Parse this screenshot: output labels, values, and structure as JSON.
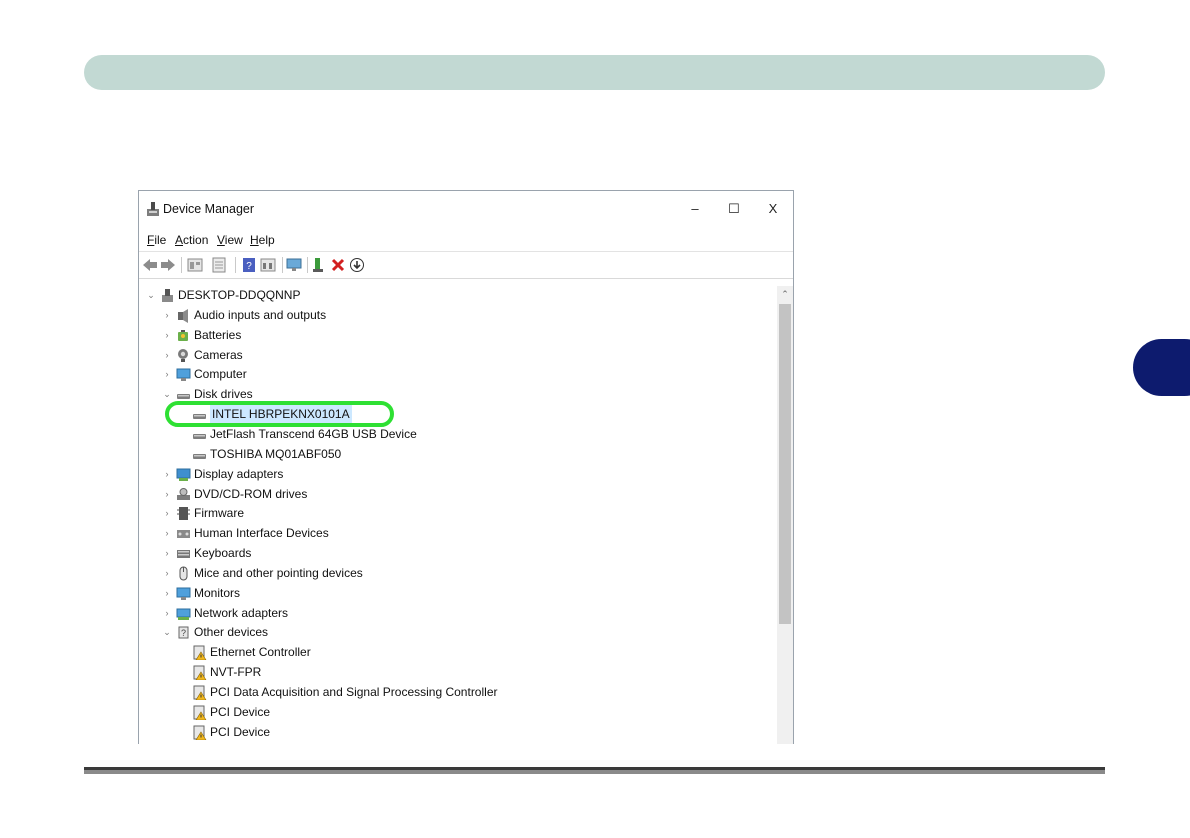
{
  "window": {
    "title": "Device Manager",
    "controls": {
      "minimize": "–",
      "maximize": "☐",
      "close": "X"
    }
  },
  "menu": {
    "items": [
      {
        "u": "F",
        "rest": "ile"
      },
      {
        "u": "A",
        "rest": "ction"
      },
      {
        "u": "V",
        "rest": "iew"
      },
      {
        "u": "H",
        "rest": "elp"
      }
    ]
  },
  "toolbar": {
    "icons": [
      "back-arrow-icon",
      "forward-arrow-icon",
      "properties-icon",
      "update-driver-list-icon",
      "help-icon",
      "show-hidden-icon",
      "monitor-icon",
      "enable-device-icon",
      "uninstall-icon",
      "scan-changes-icon"
    ]
  },
  "tree": {
    "rows": [
      {
        "label": "DESKTOP-DDQQNNP",
        "level": 0,
        "chevron": "⌄",
        "icon": "computer-root-icon"
      },
      {
        "label": "Audio inputs and outputs",
        "level": 1,
        "chevron": "›",
        "icon": "speaker-icon"
      },
      {
        "label": "Batteries",
        "level": 1,
        "chevron": "›",
        "icon": "battery-icon"
      },
      {
        "label": "Cameras",
        "level": 1,
        "chevron": "›",
        "icon": "camera-icon"
      },
      {
        "label": "Computer",
        "level": 1,
        "chevron": "›",
        "icon": "monitor-icon"
      },
      {
        "label": "Disk drives",
        "level": 1,
        "chevron": "⌄",
        "icon": "disk-drive-icon"
      },
      {
        "label": "INTEL HBRPEKNX0101A",
        "level": 2,
        "chevron": "",
        "icon": "disk-drive-icon",
        "selected": true
      },
      {
        "label": "JetFlash Transcend 64GB USB Device",
        "level": 2,
        "chevron": "",
        "icon": "disk-drive-icon"
      },
      {
        "label": "TOSHIBA MQ01ABF050",
        "level": 2,
        "chevron": "",
        "icon": "disk-drive-icon"
      },
      {
        "label": "Display adapters",
        "level": 1,
        "chevron": "›",
        "icon": "display-adapter-icon"
      },
      {
        "label": "DVD/CD-ROM drives",
        "level": 1,
        "chevron": "›",
        "icon": "dvd-drive-icon"
      },
      {
        "label": "Firmware",
        "level": 1,
        "chevron": "›",
        "icon": "firmware-chip-icon"
      },
      {
        "label": "Human Interface Devices",
        "level": 1,
        "chevron": "›",
        "icon": "hid-icon"
      },
      {
        "label": "Keyboards",
        "level": 1,
        "chevron": "›",
        "icon": "keyboard-icon"
      },
      {
        "label": "Mice and other pointing devices",
        "level": 1,
        "chevron": "›",
        "icon": "mouse-icon"
      },
      {
        "label": "Monitors",
        "level": 1,
        "chevron": "›",
        "icon": "monitor-icon"
      },
      {
        "label": "Network adapters",
        "level": 1,
        "chevron": "›",
        "icon": "network-adapter-icon"
      },
      {
        "label": "Other devices",
        "level": 1,
        "chevron": "⌄",
        "icon": "unknown-device-icon"
      },
      {
        "label": "Ethernet Controller",
        "level": 2,
        "chevron": "",
        "icon": "warning-device-icon"
      },
      {
        "label": "NVT-FPR",
        "level": 2,
        "chevron": "",
        "icon": "warning-device-icon"
      },
      {
        "label": "PCI Data Acquisition and Signal Processing Controller",
        "level": 2,
        "chevron": "",
        "icon": "warning-device-icon"
      },
      {
        "label": "PCI Device",
        "level": 2,
        "chevron": "",
        "icon": "warning-device-icon"
      },
      {
        "label": "PCI Device",
        "level": 2,
        "chevron": "",
        "icon": "warning-device-icon"
      }
    ]
  },
  "colors": {
    "header_bar": "#c2d9d3",
    "chapter_tab": "#0d1b6e",
    "highlight_ring": "#2ee033",
    "selection": "#cce8ff"
  }
}
